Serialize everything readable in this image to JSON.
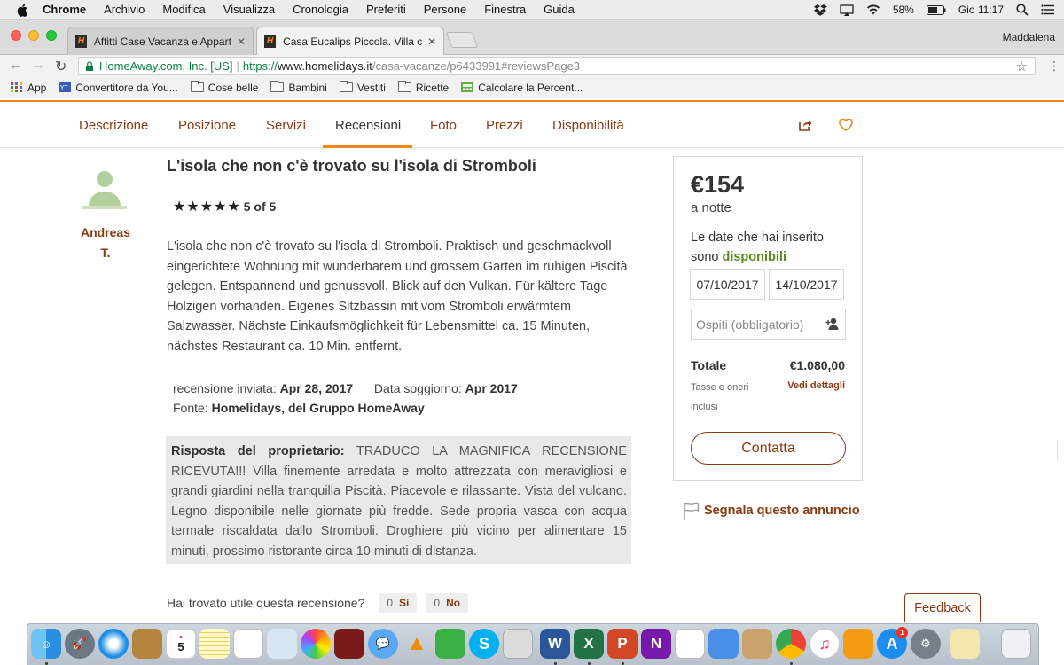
{
  "menubar": {
    "items": [
      "Chrome",
      "Archivio",
      "Modifica",
      "Visualizza",
      "Cronologia",
      "Preferiti",
      "Persone",
      "Finestra",
      "Guida"
    ],
    "battery": "58%",
    "clock": "Gio 11:17"
  },
  "tabs": [
    {
      "title": "Affitti Case Vacanza e Apparta"
    },
    {
      "title": "Casa Eucalips Piccola. Villa co"
    }
  ],
  "profile": "Maddalena",
  "address": {
    "secure_label": "HomeAway.com, Inc. [US]",
    "protocol": "https://",
    "host": "www.homelidays.it",
    "path": "/casa-vacanze/p6433991#reviewsPage3"
  },
  "bookmarks": [
    {
      "label": "App",
      "icon": "apps-grid-icon"
    },
    {
      "label": "Convertitore da You...",
      "icon": "youtube-converter-icon"
    },
    {
      "label": "Cose belle",
      "icon": "folder-icon"
    },
    {
      "label": "Bambini",
      "icon": "folder-icon"
    },
    {
      "label": "Vestiti",
      "icon": "folder-icon"
    },
    {
      "label": "Ricette",
      "icon": "folder-icon"
    },
    {
      "label": "Calcolare la Percent...",
      "icon": "calculator-icon"
    }
  ],
  "nav": {
    "items": [
      "Descrizione",
      "Posizione",
      "Servizi",
      "Recensioni",
      "Foto",
      "Prezzi",
      "Disponibilità"
    ],
    "active": "Recensioni"
  },
  "review": {
    "author_first": "Andreas",
    "author_last": "T.",
    "title": "L'isola che non c'è trovato su l'isola di Stromboli",
    "rating_text": "5 of 5",
    "rating": 5,
    "body": "L'isola che non c'è trovato su l'isola di Stromboli. Praktisch und geschmackvoll eingerichtete Wohnung mit wunderbarem und grossem Garten im ruhigen Piscità gelegen. Entspannend und genussvoll. Blick auf den Vulkan. Für kältere Tage Holzigen vorhanden. Eigenes Sitzbassin mit vom Stromboli erwärmtem Salzwasser. Nächste Einkaufsmöglichkeit für Lebensmittel ca. 15 Minuten, nächstes Restaurant ca. 10 Min. entfernt.",
    "sent_label": "recensione inviata:",
    "sent_date": "Apr 28, 2017",
    "stay_label": "Data soggiorno:",
    "stay_date": "Apr 2017",
    "source_label": "Fonte:",
    "source_value": "Homelidays, del Gruppo HomeAway",
    "reply_label": "Risposta del proprietario:",
    "reply_text": "TRADUCO LA MAGNIFICA RECENSIONE RICEVUTA!!! Villa finemente arredata e molto attrezzata con meravigliosi e grandi giardini nella tranquilla Piscità. Piacevole e rilassante. Vista del vulcano. Legno disponibile nelle giornate più fredde. Sede propria vasca con acqua termale riscaldata dallo Stromboli. Droghiere più vicino per alimentare 15 minuti, prossimo ristorante circa 10 minuti di distanza.",
    "helpful_q": "Hai trovato utile questa recensione?",
    "yes_count": "0",
    "yes_label": "Sì",
    "no_count": "0",
    "no_label": "No"
  },
  "booking": {
    "price": "€154",
    "per_night": "a notte",
    "avail_text": "Le date che hai inserito sono",
    "avail_status": "disponibili",
    "checkin": "07/10/2017",
    "checkout": "14/10/2017",
    "guests_placeholder": "Ospiti (obbligatorio)",
    "total_label": "Totale",
    "total_value": "€1.080,00",
    "tax_note": "Tasse e oneri inclusi",
    "details_link": "Vedi dettagli",
    "contact_label": "Contatta"
  },
  "report_link": "Segnala questo annuncio",
  "feedback_label": "Feedback",
  "calendar_day": "5",
  "appstore_badge": "1",
  "colors": {
    "accent_orange": "#f58220",
    "brand_brown": "#8a3a12",
    "available_green": "#5a8a1c"
  }
}
